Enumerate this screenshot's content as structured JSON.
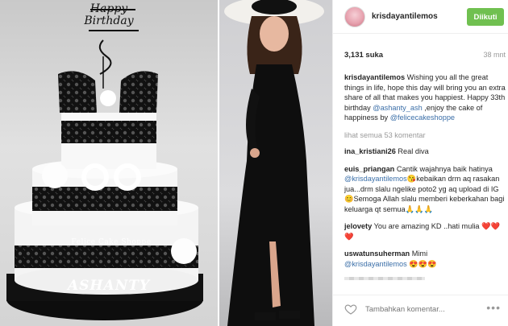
{
  "post": {
    "username": "krisdayantilemos",
    "follow_label": "Diikuti",
    "likes": "3,131 suka",
    "time": "38 mnt"
  },
  "photo": {
    "topper_text": "Happy Birthday",
    "cake_label": "Felice Cake Shoppe",
    "cake_name": "ASHANTY"
  },
  "caption": {
    "user": "krisdayantilemos",
    "text": "Wishing you all the great things in life, hope this day will bring you an extra share of all that makes you happiest. Happy 33th birthday",
    "mention1": "@ashanty_ash",
    "text2": ",enjoy the cake of happiness by",
    "mention2": "@felicecakeshoppe"
  },
  "more_comments": "lihat semua 53 komentar",
  "comments": [
    {
      "user": "ina_kristiani26",
      "text": "Real diva"
    },
    {
      "user": "euis_priangan",
      "text_before": "Cantik wajahnya baik hatinya",
      "mention": "@krisdayantilemos",
      "text_after": "😘kebaikan drm aq rasakan jua...drm slalu ngelike poto2 yg aq upload di IG😊Semoga Allah slalu memberi keberkahan bagi keluarga qt semua🙏🙏🙏"
    },
    {
      "user": "jelovety",
      "text": "You are amazing KD ..hati mulia ❤️❤️❤️"
    },
    {
      "user": "uswatunsuherman",
      "text": "Mimi",
      "mention": "@krisdayantilemos",
      "text_after": "😍😍😍"
    }
  ],
  "footer": {
    "placeholder": "Tambahkan komentar...",
    "more_label": "•••"
  },
  "icons": {
    "heart": "heart-icon",
    "more": "more-options-icon"
  },
  "colors": {
    "follow_button": "#70c050",
    "link": "#3b6fa8"
  }
}
